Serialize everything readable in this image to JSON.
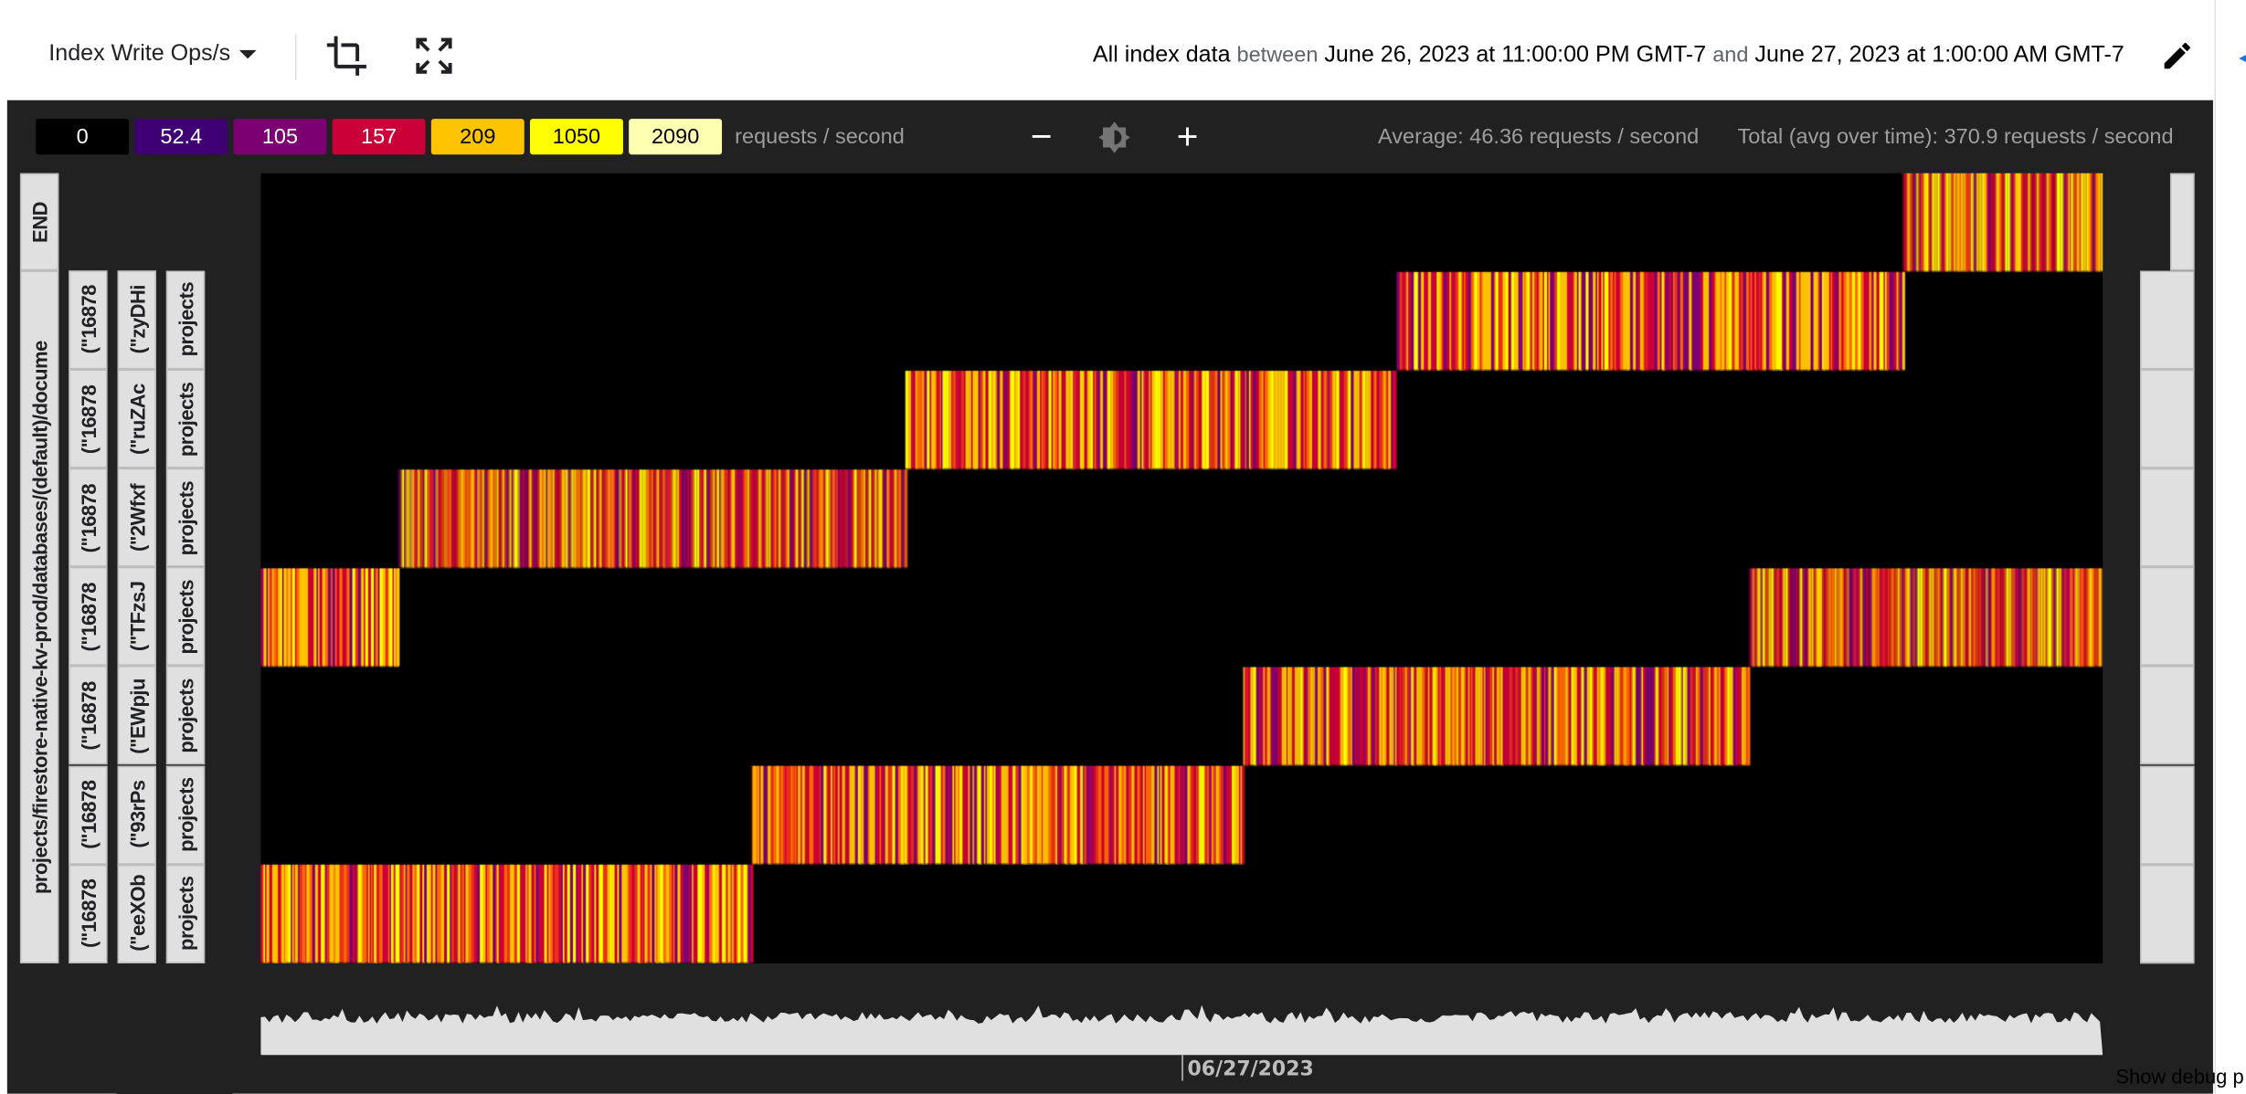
{
  "header": {
    "metric_label": "Index Write Ops/s",
    "range": {
      "prefix": "All index data",
      "between": "between",
      "start": "June 26, 2023 at 11:00:00 PM GMT-7",
      "and": "and",
      "end": "June 27, 2023 at 1:00:00 AM GMT-7"
    },
    "icons": [
      "crop-icon",
      "fullscreen-icon",
      "pencil-icon"
    ]
  },
  "legend": {
    "steps": [
      {
        "label": "0",
        "color": "#000000",
        "text": "#ffffff"
      },
      {
        "label": "52.4",
        "color": "#3f0074",
        "text": "#ffffff"
      },
      {
        "label": "105",
        "color": "#7d0072",
        "text": "#ffffff"
      },
      {
        "label": "157",
        "color": "#cc0038",
        "text": "#ffffff"
      },
      {
        "label": "209",
        "color": "#ffc400",
        "text": "#000000"
      },
      {
        "label": "1050",
        "color": "#ffff00",
        "text": "#000000"
      },
      {
        "label": "2090",
        "color": "#ffffb2",
        "text": "#000000"
      }
    ],
    "units": "requests / second"
  },
  "controls": {
    "zoom_out": "−",
    "zoom_in": "+"
  },
  "stats": {
    "average": "Average: 46.36 requests / second",
    "total": "Total (avg over time): 370.9 requests / second"
  },
  "heatmap": {
    "time_range": [
      "23:00",
      "01:00"
    ],
    "rows": [
      {
        "segments": [
          [
            "00:47",
            "01:00"
          ]
        ]
      },
      {
        "segments": [
          [
            "00:14",
            "00:47"
          ]
        ]
      },
      {
        "segments": [
          [
            "23:42",
            "00:14"
          ]
        ]
      },
      {
        "segments": [
          [
            "23:09",
            "23:42"
          ]
        ]
      },
      {
        "segments": [
          [
            "23:00",
            "23:09"
          ],
          [
            "00:37",
            "01:00"
          ]
        ]
      },
      {
        "segments": [
          [
            "00:04",
            "00:37"
          ]
        ]
      },
      {
        "segments": [
          [
            "23:32",
            "00:04"
          ]
        ]
      },
      {
        "segments": [
          [
            "23:00",
            "23:32"
          ]
        ]
      }
    ]
  },
  "keys": {
    "end": "END",
    "prefix": "projects/firestore-native-kv-prod/databases/(default)/docume",
    "col2": [
      "(\"16878",
      "(\"16878",
      "(\"16878",
      "(\"16878",
      "(\"16878",
      "(\"16878",
      "(\"16878"
    ],
    "col3": [
      "(\"zyDHi",
      "(\"ruZAc",
      "(\"2Wfxf",
      "(\"TFzsJ",
      "(\"EWpju",
      "(\"93rPs",
      "(\"eeXOb"
    ],
    "col4": [
      "projects",
      "projects",
      "projects",
      "projects",
      "projects",
      "projects",
      "projects"
    ]
  },
  "timeline": {
    "date_label": "06/27/2023"
  },
  "footer": {
    "debug": "Show debug p"
  }
}
